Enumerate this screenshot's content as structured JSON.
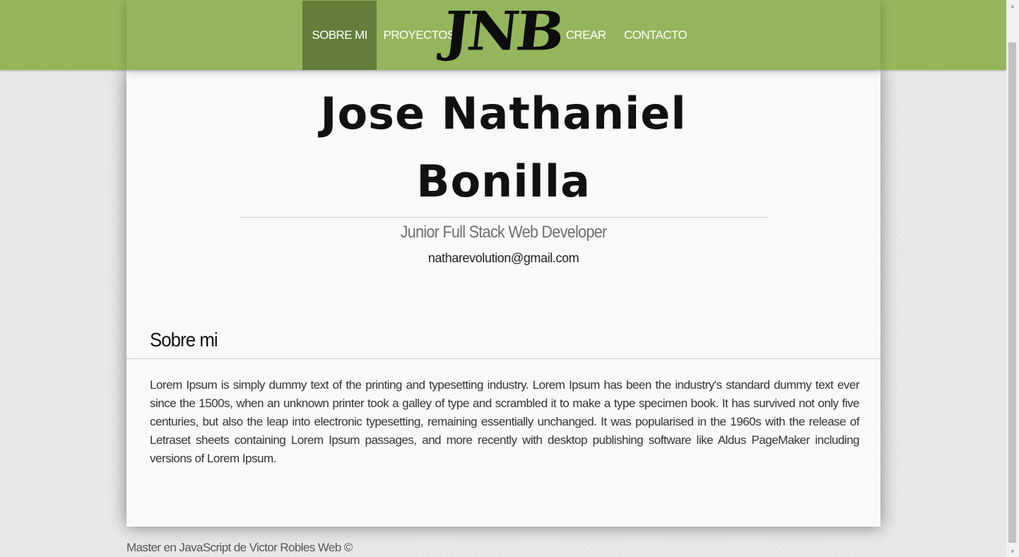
{
  "nav": {
    "items": [
      {
        "label": "SOBRE MI",
        "active": true
      },
      {
        "label": "PROYECTOS",
        "active": false
      },
      {
        "label": "CREAR",
        "active": false
      },
      {
        "label": "CONTACTO",
        "active": false
      }
    ],
    "logo": "JNB"
  },
  "hero": {
    "name_line1": "Jose Nathaniel",
    "name_line2": "Bonilla",
    "role": "Junior Full Stack Web Developer",
    "email": "natharevolution@gmail.com"
  },
  "about": {
    "title": "Sobre mi",
    "body": "Lorem Ipsum is simply dummy text of the printing and typesetting industry. Lorem Ipsum has been the industry's standard dummy text ever since the 1500s, when an unknown printer took a galley of type and scrambled it to make a type specimen book. It has survived not only five centuries, but also the leap into electronic typesetting, remaining essentially unchanged. It was popularised in the 1960s with the release of Letraset sheets containing Lorem Ipsum passages, and more recently with desktop publishing software like Aldus PageMaker including versions of Lorem Ipsum."
  },
  "footer": {
    "text": "Master en JavaScript de Victor Robles Web ©"
  },
  "colors": {
    "header_green": "#95b75c",
    "nav_active": "#627e3a",
    "panel_bg": "#f9f9f9"
  },
  "icons": {
    "scroll_up": "triangle-up",
    "scroll_down": "triangle-down"
  }
}
